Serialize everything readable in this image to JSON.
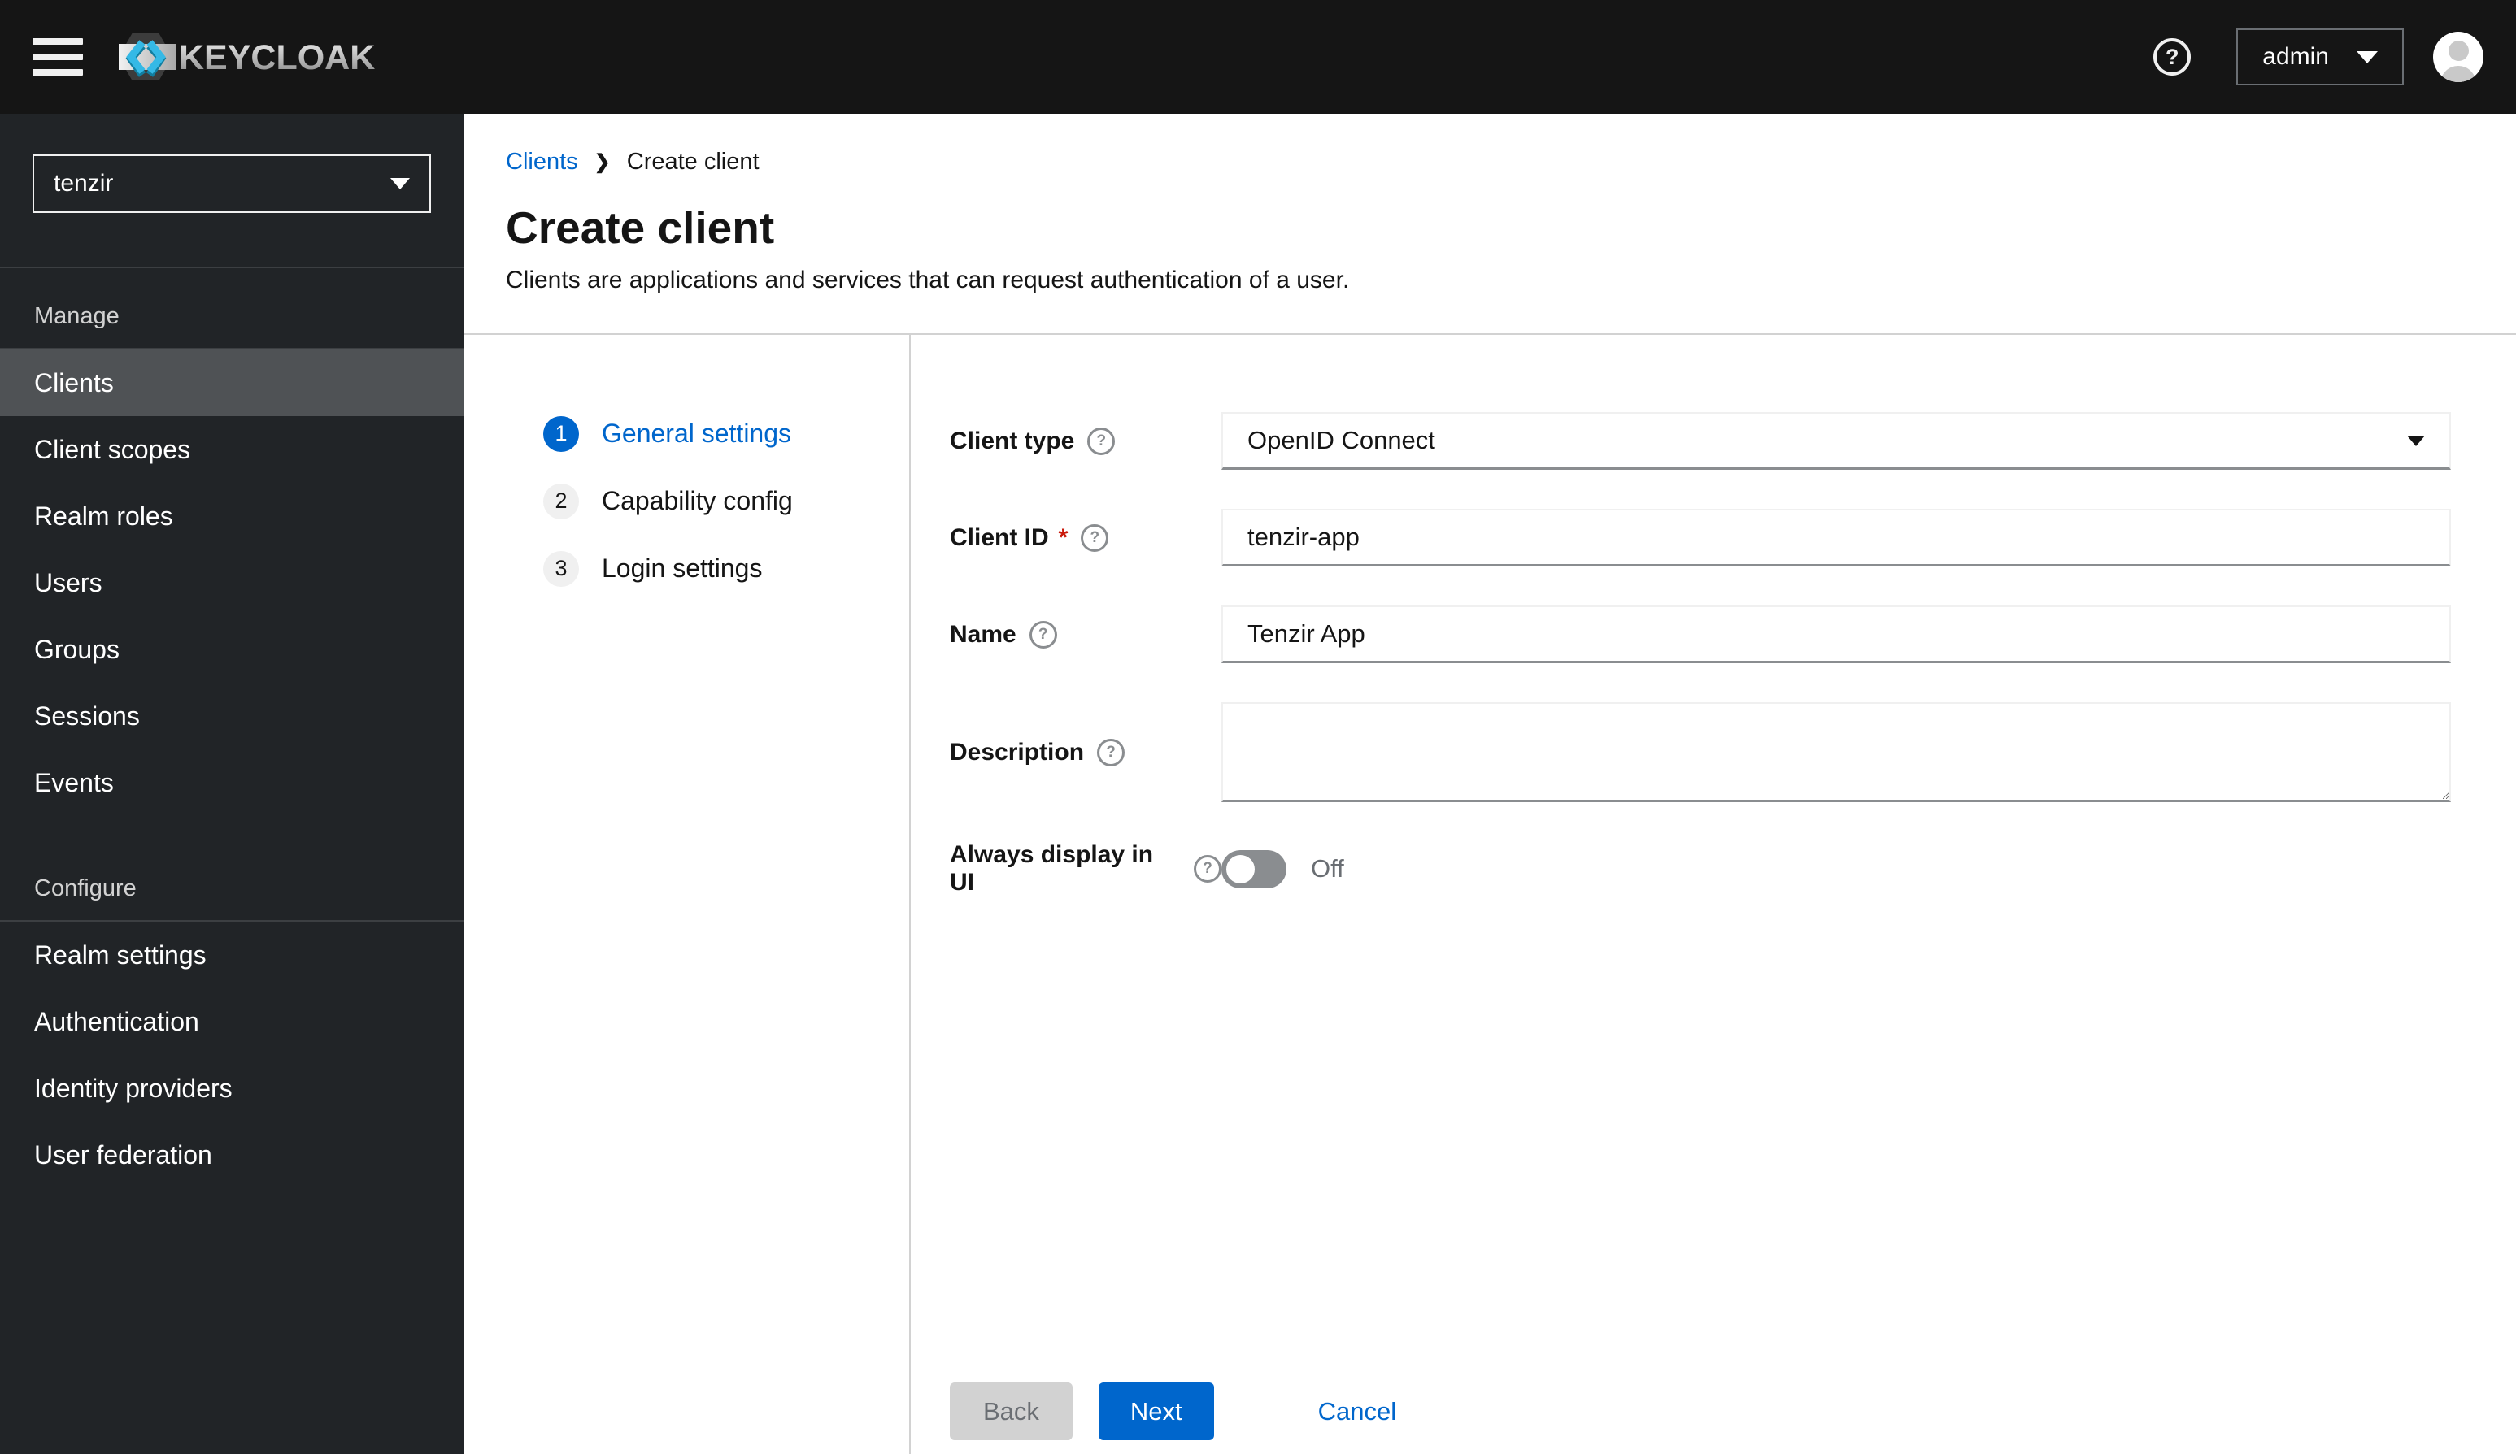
{
  "masthead": {
    "brand": "KEYCLOAK",
    "user_menu": "admin"
  },
  "icons": {
    "help": "?",
    "breadcrumb_separator": "❯"
  },
  "colors": {
    "primary": "#0066cc",
    "masthead_bg": "#151515",
    "sidebar_bg": "#212427",
    "nav_current_bg": "#4f5255",
    "danger": "#c9190b",
    "divider": "#d2d2d2",
    "logo_cyan": "#33b1d6"
  },
  "sidebar": {
    "realm_selector": "tenzir",
    "sections": [
      {
        "title": "Manage",
        "items": [
          {
            "label": "Clients",
            "current": true
          },
          {
            "label": "Client scopes"
          },
          {
            "label": "Realm roles"
          },
          {
            "label": "Users"
          },
          {
            "label": "Groups"
          },
          {
            "label": "Sessions"
          },
          {
            "label": "Events"
          }
        ]
      },
      {
        "title": "Configure",
        "items": [
          {
            "label": "Realm settings"
          },
          {
            "label": "Authentication"
          },
          {
            "label": "Identity providers"
          },
          {
            "label": "User federation"
          }
        ]
      }
    ]
  },
  "breadcrumb": {
    "parent": "Clients",
    "current": "Create client"
  },
  "page": {
    "title": "Create client",
    "subtitle": "Clients are applications and services that can request authentication of a user."
  },
  "wizard": {
    "steps": [
      {
        "num": "1",
        "label": "General settings",
        "current": true
      },
      {
        "num": "2",
        "label": "Capability config"
      },
      {
        "num": "3",
        "label": "Login settings"
      }
    ]
  },
  "form": {
    "client_type": {
      "label": "Client type",
      "value": "OpenID Connect"
    },
    "client_id": {
      "label": "Client ID",
      "required": "*",
      "value": "tenzir-app"
    },
    "name": {
      "label": "Name",
      "value": "Tenzir App"
    },
    "description": {
      "label": "Description",
      "value": ""
    },
    "always_display": {
      "label": "Always display in UI",
      "state": "Off"
    }
  },
  "actions": {
    "back": "Back",
    "next": "Next",
    "cancel": "Cancel"
  }
}
